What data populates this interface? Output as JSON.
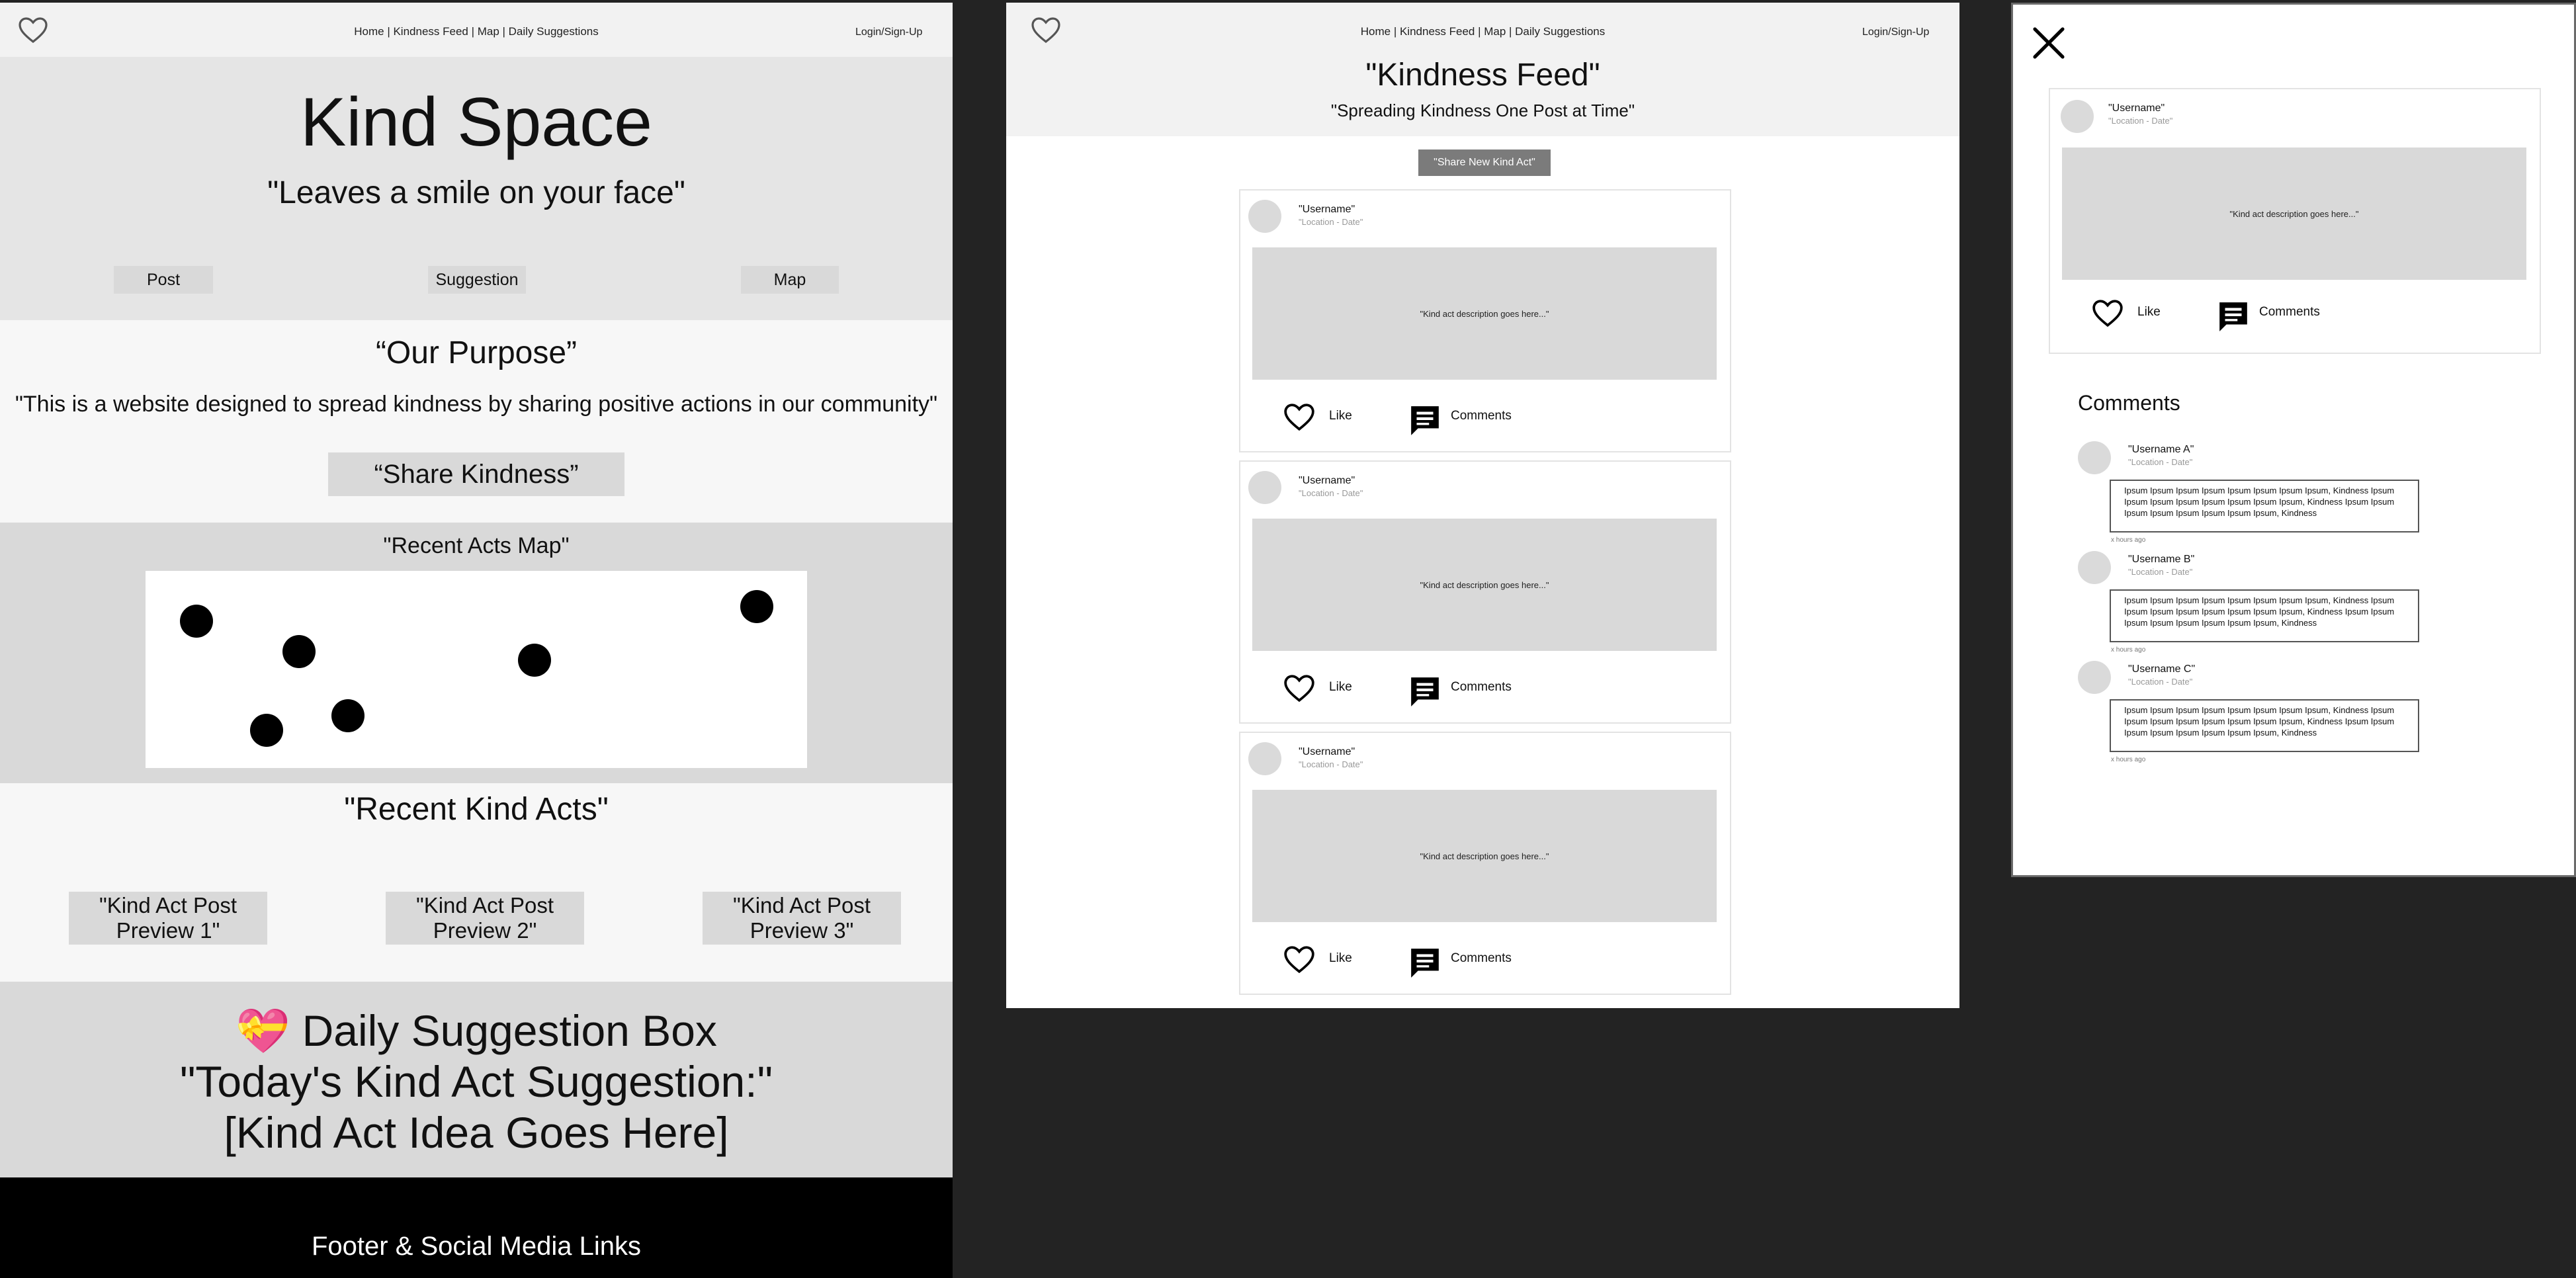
{
  "home": {
    "nav_links": "Home | Kindness Feed | Map | Daily Suggestions",
    "login": "Login/Sign-Up",
    "title": "Kind Space",
    "tagline": "\"Leaves a smile on your face\"",
    "quick_buttons": [
      "Post",
      "Suggestion",
      "Map"
    ],
    "purpose_title": "“Our Purpose”",
    "purpose_text": "\"This is a website designed to spread kindness by sharing positive actions in our community\"",
    "share_button": "“Share Kindness”",
    "map_title": "\"Recent Acts Map\"",
    "recent_title": "\"Recent Kind Acts\"",
    "previews": [
      "\"Kind Act Post Preview 1\"",
      "\"Kind Act Post Preview 2\"",
      "\"Kind Act Post Preview 3\""
    ],
    "suggestion_emoji": "💝",
    "suggestion_title": "Daily Suggestion Box",
    "suggestion_line": "\"Today's Kind Act Suggestion:\"",
    "suggestion_idea": "[Kind Act Idea Goes Here]",
    "footer": "Footer & Social Media Links"
  },
  "feed": {
    "nav_links": "Home | Kindness Feed | Map | Daily Suggestions",
    "login": "Login/Sign-Up",
    "title": "\"Kindness Feed\"",
    "subtitle": "\"Spreading Kindness One Post at Time\"",
    "share_button": "\"Share New Kind Act\"",
    "posts": [
      {
        "username": "\"Username\"",
        "meta": "\"Location - Date\"",
        "description": "\"Kind act description goes here...\"",
        "like": "Like",
        "comments": "Comments"
      },
      {
        "username": "\"Username\"",
        "meta": "\"Location - Date\"",
        "description": "\"Kind act description goes here...\"",
        "like": "Like",
        "comments": "Comments"
      },
      {
        "username": "\"Username\"",
        "meta": "\"Location - Date\"",
        "description": "\"Kind act description goes here...\"",
        "like": "Like",
        "comments": "Comments"
      }
    ]
  },
  "detail": {
    "post": {
      "username": "\"Username\"",
      "meta": "\"Location - Date\"",
      "description": "\"Kind act description goes here...\"",
      "like": "Like",
      "comments": "Comments"
    },
    "comments_title": "Comments",
    "comments": [
      {
        "username": "\"Username A\"",
        "meta": "\"Location - Date\"",
        "text": "Ipsum Ipsum Ipsum Ipsum Ipsum Ipsum Ipsum Ipsum, Kindness Ipsum Ipsum Ipsum Ipsum Ipsum Ipsum Ipsum Ipsum, Kindness Ipsum Ipsum Ipsum Ipsum Ipsum Ipsum Ipsum Ipsum, Kindness",
        "time": "x hours ago"
      },
      {
        "username": "\"Username B\"",
        "meta": "\"Location - Date\"",
        "text": "Ipsum Ipsum Ipsum Ipsum Ipsum Ipsum Ipsum Ipsum, Kindness Ipsum Ipsum Ipsum Ipsum Ipsum Ipsum Ipsum Ipsum, Kindness Ipsum Ipsum Ipsum Ipsum Ipsum Ipsum Ipsum Ipsum, Kindness",
        "time": "x hours ago"
      },
      {
        "username": "\"Username C\"",
        "meta": "\"Location - Date\"",
        "text": "Ipsum Ipsum Ipsum Ipsum Ipsum Ipsum Ipsum Ipsum, Kindness Ipsum Ipsum Ipsum Ipsum Ipsum Ipsum Ipsum Ipsum, Kindness Ipsum Ipsum Ipsum Ipsum Ipsum Ipsum Ipsum Ipsum, Kindness",
        "time": "x hours ago"
      }
    ]
  },
  "icons": [
    "heart-icon",
    "comment-icon",
    "close-icon"
  ],
  "colors": {
    "canvas": "#232323",
    "section_grey": "#e5e5e5",
    "placeholder_grey": "#d9d9d9",
    "footer": "#000000"
  }
}
